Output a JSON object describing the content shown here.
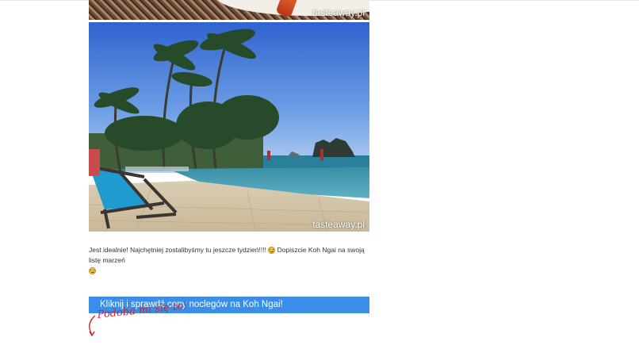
{
  "photos": {
    "watermark": "tasteaway.pl"
  },
  "caption": {
    "text_part1": "Jest idealnie! Najchętniej zostalibyśmy tu jeszcze tydzień!!!! ",
    "text_part2": " Dopiszcie Koh Ngai na swoją listę marzeń "
  },
  "cta": {
    "label": "Kliknij i sprawdź ceny noclegów na Koh Ngai!",
    "color": "#3a8ee8"
  },
  "like": {
    "label": "Podoba mi się to!",
    "color": "#d1262f"
  }
}
